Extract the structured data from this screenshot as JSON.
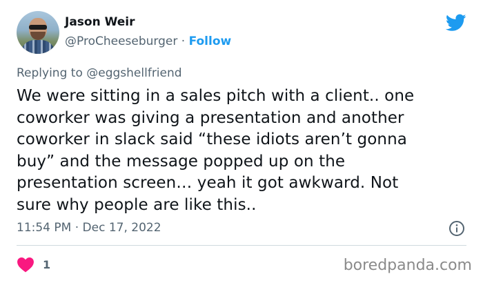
{
  "author": {
    "name": "Jason Weir",
    "handle": "@ProCheeseburger",
    "separator": "·",
    "follow_label": "Follow"
  },
  "reply": {
    "prefix": "Replying to ",
    "to_handle": "@eggshellfriend"
  },
  "tweet": {
    "lines": [
      "We were sitting in a sales pitch with a client.. one",
      "coworker was giving a presentation and another",
      "coworker in slack said “these idiots aren’t gonna",
      "buy” and the message popped up on the",
      "presentation screen… yeah it got awkward. Not",
      "sure why people are like this.."
    ],
    "timestamp": "11:54 PM · Dec 17, 2022"
  },
  "engagement": {
    "like_count": "1"
  },
  "watermark": "boredpanda.com",
  "colors": {
    "accent": "#1d9bf0",
    "text": "#0f1419",
    "muted": "#536471",
    "heart": "#f91880",
    "divider": "#cfd9de"
  },
  "icons": {
    "brand": "twitter-bird-icon",
    "info": "info-icon",
    "like": "heart-icon"
  }
}
